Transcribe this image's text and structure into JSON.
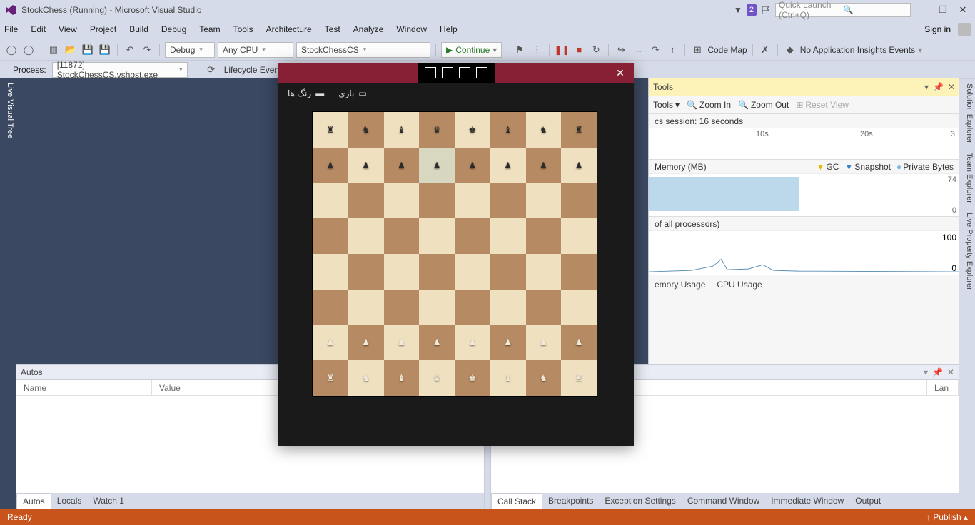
{
  "title": "StockChess (Running) - Microsoft Visual Studio",
  "notification_count": "2",
  "quick_launch_placeholder": "Quick Launch (Ctrl+Q)",
  "signin": "Sign in",
  "menu": [
    "File",
    "Edit",
    "View",
    "Project",
    "Build",
    "Debug",
    "Team",
    "Tools",
    "Architecture",
    "Test",
    "Analyze",
    "Window",
    "Help"
  ],
  "toolbar": {
    "config": "Debug",
    "platform": "Any CPU",
    "startup": "StockChessCS",
    "continue": "Continue",
    "codemap": "Code Map",
    "insights": "No Application Insights Events"
  },
  "debugbar": {
    "process_lbl": "Process:",
    "process_val": "[11872] StockChessCS.vshost.exe",
    "lifecycle": "Lifecycle Events"
  },
  "left_tab": "Live Visual Tree",
  "right_tabs": [
    "Solution Explorer",
    "Team Explorer",
    "Live Property Explorer"
  ],
  "diag": {
    "header": "Tools",
    "tools_dd": "Tools",
    "zoom_in": "Zoom In",
    "zoom_out": "Zoom Out",
    "reset": "Reset View",
    "session": "cs session: 16 seconds",
    "ticks": [
      "10s",
      "20s",
      "3"
    ],
    "mem_label": "Memory (MB)",
    "mem_markers": {
      "gc": "GC",
      "snap": "Snapshot",
      "priv": "Private Bytes"
    },
    "mem_y": [
      "74",
      "0"
    ],
    "cpu_label": "of all processors)",
    "cpu_y": [
      "100",
      "0"
    ],
    "tabs": [
      "emory Usage",
      "CPU Usage"
    ]
  },
  "autos": {
    "title": "Autos",
    "cols": [
      "Name",
      "Value"
    ],
    "tabs": [
      "Autos",
      "Locals",
      "Watch 1"
    ]
  },
  "right_panel": {
    "col": "Lan",
    "tabs": [
      "Call Stack",
      "Breakpoints",
      "Exception Settings",
      "Command Window",
      "Immediate Window",
      "Output"
    ]
  },
  "status": {
    "ready": "Ready",
    "publish": "Publish"
  },
  "app": {
    "menu1": "بازی",
    "menu2": "رنگ ها",
    "board": [
      [
        "r",
        "n",
        "b",
        "q",
        "k",
        "b",
        "n",
        "r"
      ],
      [
        "p",
        "p",
        "p",
        "p",
        "p",
        "p",
        "p",
        "p"
      ],
      [
        "",
        "",
        "",
        "",
        "",
        "",
        "",
        ""
      ],
      [
        "",
        "",
        "",
        "",
        "",
        "",
        "",
        ""
      ],
      [
        "",
        "",
        "",
        "",
        "",
        "",
        "",
        ""
      ],
      [
        "",
        "",
        "",
        "",
        "",
        "",
        "",
        ""
      ],
      [
        "P",
        "P",
        "P",
        "P",
        "P",
        "P",
        "P",
        "P"
      ],
      [
        "R",
        "N",
        "B",
        "Q",
        "K",
        "B",
        "N",
        "R"
      ]
    ],
    "highlight": {
      "row": 1,
      "col": 3
    }
  }
}
